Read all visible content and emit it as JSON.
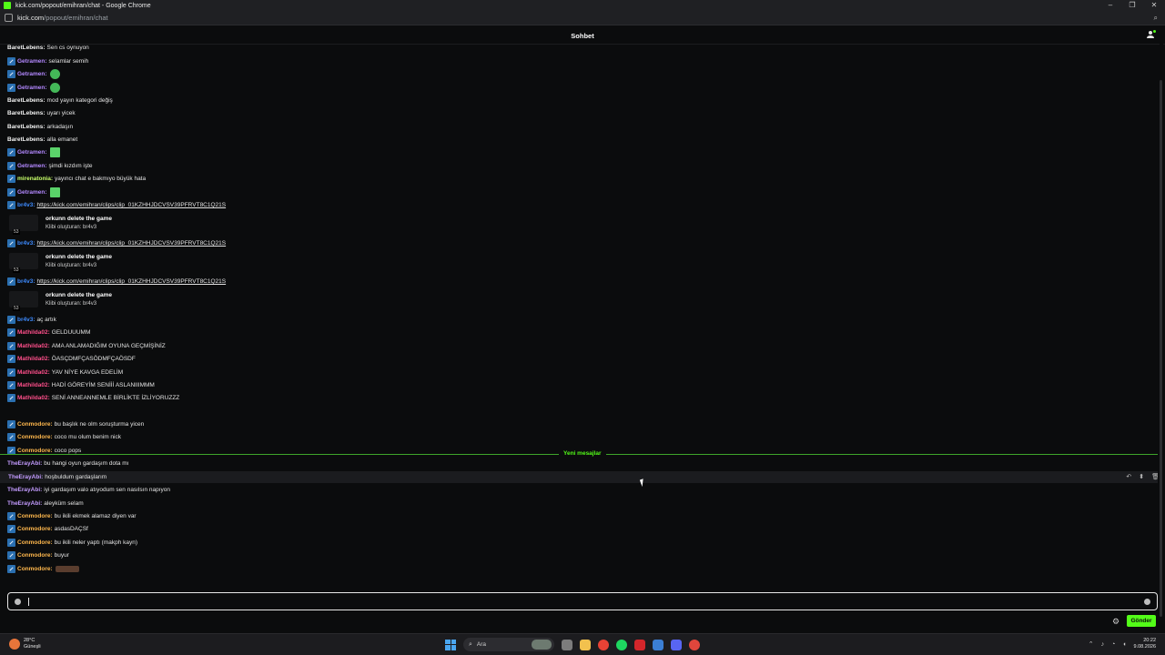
{
  "window": {
    "title": "kick.com/popout/emihran/chat - Google Chrome",
    "url_host": "kick.com",
    "url_path": "/popout/emihran/chat"
  },
  "header": {
    "title": "Sohbet"
  },
  "colors": {
    "accent": "#53fc18",
    "getramen": "#b388ff",
    "mathilda": "#ff4f8b",
    "conmodore": "#ffb84d",
    "br4v3": "#3d8bff",
    "mirenatonia": "#c8ff6a",
    "baret": "#f0f0f0",
    "therayabi": "#c39bff"
  },
  "messages": [
    {
      "user": "BaretLebens",
      "text": "Sen cs oynuyon",
      "badge": false,
      "color": "baret"
    },
    {
      "user": "Getramen",
      "text": "selamlar semih",
      "badge": true,
      "color": "getramen"
    },
    {
      "user": "Getramen",
      "text": "",
      "badge": true,
      "color": "getramen",
      "emote": "round"
    },
    {
      "user": "Getramen",
      "text": "",
      "badge": true,
      "color": "getramen",
      "emote": "round"
    },
    {
      "user": "BaretLebens",
      "text": "mod yayın kategori değiş",
      "badge": false,
      "color": "baret"
    },
    {
      "user": "BaretLebens",
      "text": "uyarı yicek",
      "badge": false,
      "color": "baret"
    },
    {
      "user": "BaretLebens",
      "text": "arkadaşın",
      "badge": false,
      "color": "baret"
    },
    {
      "user": "BaretLebens",
      "text": "alla emanet",
      "badge": false,
      "color": "baret"
    },
    {
      "user": "Getramen",
      "text": "",
      "badge": true,
      "color": "getramen",
      "emote": "tv"
    },
    {
      "user": "Getramen",
      "text": "şimdi kızdım işte",
      "badge": true,
      "color": "getramen"
    },
    {
      "user": "mirenatonia",
      "text": "yayıncı chat e bakmıyo büyük hata",
      "badge": true,
      "color": "mirenatonia"
    },
    {
      "user": "Getramen",
      "text": "",
      "badge": true,
      "color": "getramen",
      "emote": "tv"
    },
    {
      "user": "br4v3",
      "link": "https://kick.com/emihran/clips/clip_01KZHHJDCVSV39PFRVT8C1Q21S",
      "badge": true,
      "color": "br4v3"
    },
    {
      "user": "br4v3",
      "link": "https://kick.com/emihran/clips/clip_01KZHHJDCVSV39PFRVT8C1Q21S",
      "badge": true,
      "color": "br4v3"
    },
    {
      "user": "br4v3",
      "link": "https://kick.com/emihran/clips/clip_01KZHHJDCVSV39PFRVT8C1Q21S",
      "badge": true,
      "color": "br4v3"
    },
    {
      "user": "br4v3",
      "text": "aç artık",
      "badge": true,
      "color": "br4v3"
    },
    {
      "user": "Mathilda02",
      "text": "GELDUUUMM",
      "badge": true,
      "color": "mathilda"
    },
    {
      "user": "Mathilda02",
      "text": "AMA ANLAMADIĞIM OYUNA GEÇMİŞİNİZ",
      "badge": true,
      "color": "mathilda"
    },
    {
      "user": "Mathilda02",
      "text": "ÖASÇDMFÇASÖDMFÇAÖSDF",
      "badge": true,
      "color": "mathilda"
    },
    {
      "user": "Mathilda02",
      "text": "YAV NİYE KAVGA EDELİM",
      "badge": true,
      "color": "mathilda"
    },
    {
      "user": "Mathilda02",
      "text": "HADİ GÖREYİM SENİİİ ASLANIIIMMM",
      "badge": true,
      "color": "mathilda"
    },
    {
      "user": "Mathilda02",
      "text": "SENİ ANNEANNEMLE BİRLİKTE İZLİYORUZZZ",
      "badge": true,
      "color": "mathilda"
    },
    {
      "user": "Conmodore",
      "text": "bu başlık ne olm soruşturma yicen",
      "badge": true,
      "color": "conmodore"
    },
    {
      "user": "Conmodore",
      "text": "coco mu olum benim nick",
      "badge": true,
      "color": "conmodore"
    },
    {
      "user": "Conmodore",
      "text": "coco pops",
      "badge": true,
      "color": "conmodore"
    },
    {
      "user": "TheErayAbi",
      "text": "bu hangi oyun gardaşım dota mı",
      "badge": false,
      "color": "therayabi"
    },
    {
      "user": "TheErayAbi",
      "text": "hoşbuldum gardaşlarım",
      "badge": false,
      "color": "therayabi"
    },
    {
      "user": "TheErayAbi",
      "text": "iyi gardaşım valo atıyodum sen nasılsın napıyon",
      "badge": false,
      "color": "therayabi"
    },
    {
      "user": "TheErayAbi",
      "text": "aleyküm selam",
      "badge": false,
      "color": "therayabi"
    },
    {
      "user": "Conmodore",
      "text": "bu ikili ekmek alamaz diyen var",
      "badge": true,
      "color": "conmodore"
    },
    {
      "user": "Conmodore",
      "text": "asdasDAÇSf",
      "badge": true,
      "color": "conmodore"
    },
    {
      "user": "Conmodore",
      "text": "bu ikili neler yaptı (makph kayn)",
      "badge": true,
      "color": "conmodore"
    },
    {
      "user": "Conmodore",
      "text": "buyur",
      "badge": true,
      "color": "conmodore"
    },
    {
      "user": "Conmodore",
      "text": "",
      "badge": true,
      "color": "conmodore",
      "emote": "meme"
    }
  ],
  "clip": {
    "title": "orkunn delete the game",
    "by": "Klibi oluşturan: br4v3",
    "duration": "53"
  },
  "divider": {
    "label": "Yeni mesajlar"
  },
  "input": {
    "placeholder": "",
    "value": ""
  },
  "send_button": {
    "label": "Gönder"
  },
  "taskbar": {
    "weather_temp": "28°C",
    "weather_desc": "Güneşli",
    "search_label": "Ara",
    "time": "20:22",
    "date": "9.08.2026"
  }
}
